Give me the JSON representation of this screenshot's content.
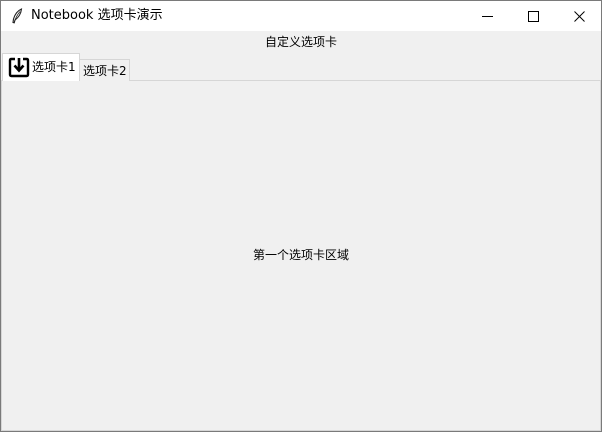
{
  "window": {
    "title": "Notebook 选项卡演示",
    "app_icon": "feather-icon",
    "controls": [
      "minimize-icon",
      "maximize-icon",
      "close-icon"
    ]
  },
  "header": {
    "label": "自定义选项卡"
  },
  "tabs": [
    {
      "label": "选项卡1",
      "icon": "download-icon",
      "selected": true
    },
    {
      "label": "选项卡2",
      "selected": false
    }
  ],
  "panel": {
    "text": "第一个选项卡区域"
  }
}
